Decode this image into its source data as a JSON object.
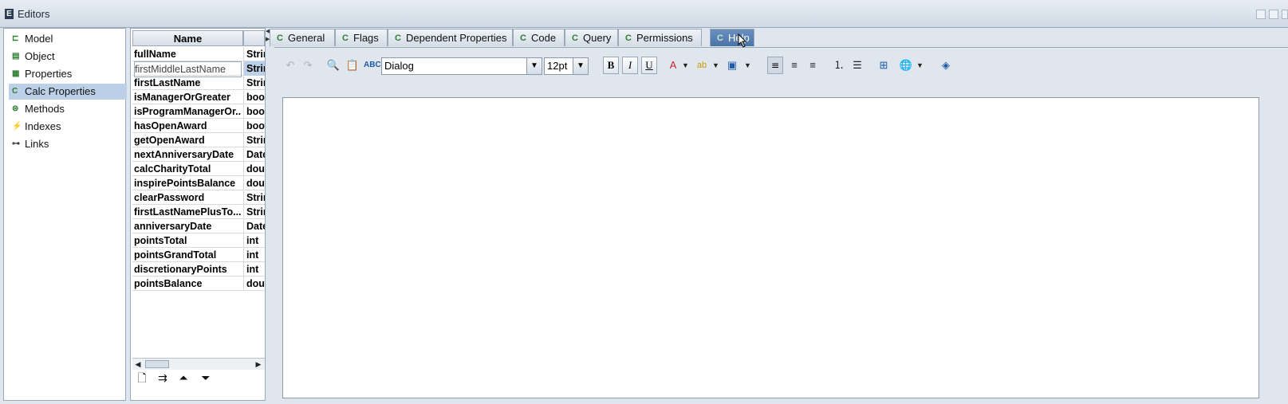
{
  "window": {
    "title": "Editors",
    "title_icon": "E"
  },
  "nav": {
    "items": [
      {
        "label": "Model",
        "icon": "model-icon"
      },
      {
        "label": "Object",
        "icon": "object-icon"
      },
      {
        "label": "Properties",
        "icon": "properties-icon"
      },
      {
        "label": "Calc Properties",
        "icon": "calc-properties-icon",
        "active": true
      },
      {
        "label": "Methods",
        "icon": "methods-icon"
      },
      {
        "label": "Indexes",
        "icon": "indexes-icon"
      },
      {
        "label": "Links",
        "icon": "links-icon"
      }
    ]
  },
  "table": {
    "columns": [
      "Name",
      ""
    ],
    "rows": [
      {
        "name": "fullName",
        "type": "Strin"
      },
      {
        "name": "firstMiddleLastName",
        "type": "Strin",
        "selected": true
      },
      {
        "name": "firstLastName",
        "type": "Strin"
      },
      {
        "name": "isManagerOrGreater",
        "type": "boo"
      },
      {
        "name": "isProgramManagerOr...",
        "type": "boo"
      },
      {
        "name": "hasOpenAward",
        "type": "boo"
      },
      {
        "name": "getOpenAward",
        "type": "Strin"
      },
      {
        "name": "nextAnniversaryDate",
        "type": "Date"
      },
      {
        "name": "calcCharityTotal",
        "type": "dou"
      },
      {
        "name": "inspirePointsBalance",
        "type": "dou"
      },
      {
        "name": "clearPassword",
        "type": "Strin"
      },
      {
        "name": "firstLastNamePlusTo...",
        "type": "Strin"
      },
      {
        "name": "anniversaryDate",
        "type": "Date"
      },
      {
        "name": "pointsTotal",
        "type": "int"
      },
      {
        "name": "pointsGrandTotal",
        "type": "int"
      },
      {
        "name": "discretionaryPoints",
        "type": "int"
      },
      {
        "name": "pointsBalance",
        "type": "dou"
      }
    ]
  },
  "tabs": [
    {
      "label": "General"
    },
    {
      "label": "Flags"
    },
    {
      "label": "Dependent Properties"
    },
    {
      "label": "Code"
    },
    {
      "label": "Query"
    },
    {
      "label": "Permissions"
    },
    {
      "label": "Help",
      "active": true
    }
  ],
  "editor": {
    "font": "Dialog",
    "size": "12pt",
    "bold": "B",
    "italic": "I",
    "underline": "U"
  },
  "colors": {
    "accent": "#4a73a8",
    "selection": "#bcd0e8",
    "tab_icon": "#2e7d32"
  }
}
